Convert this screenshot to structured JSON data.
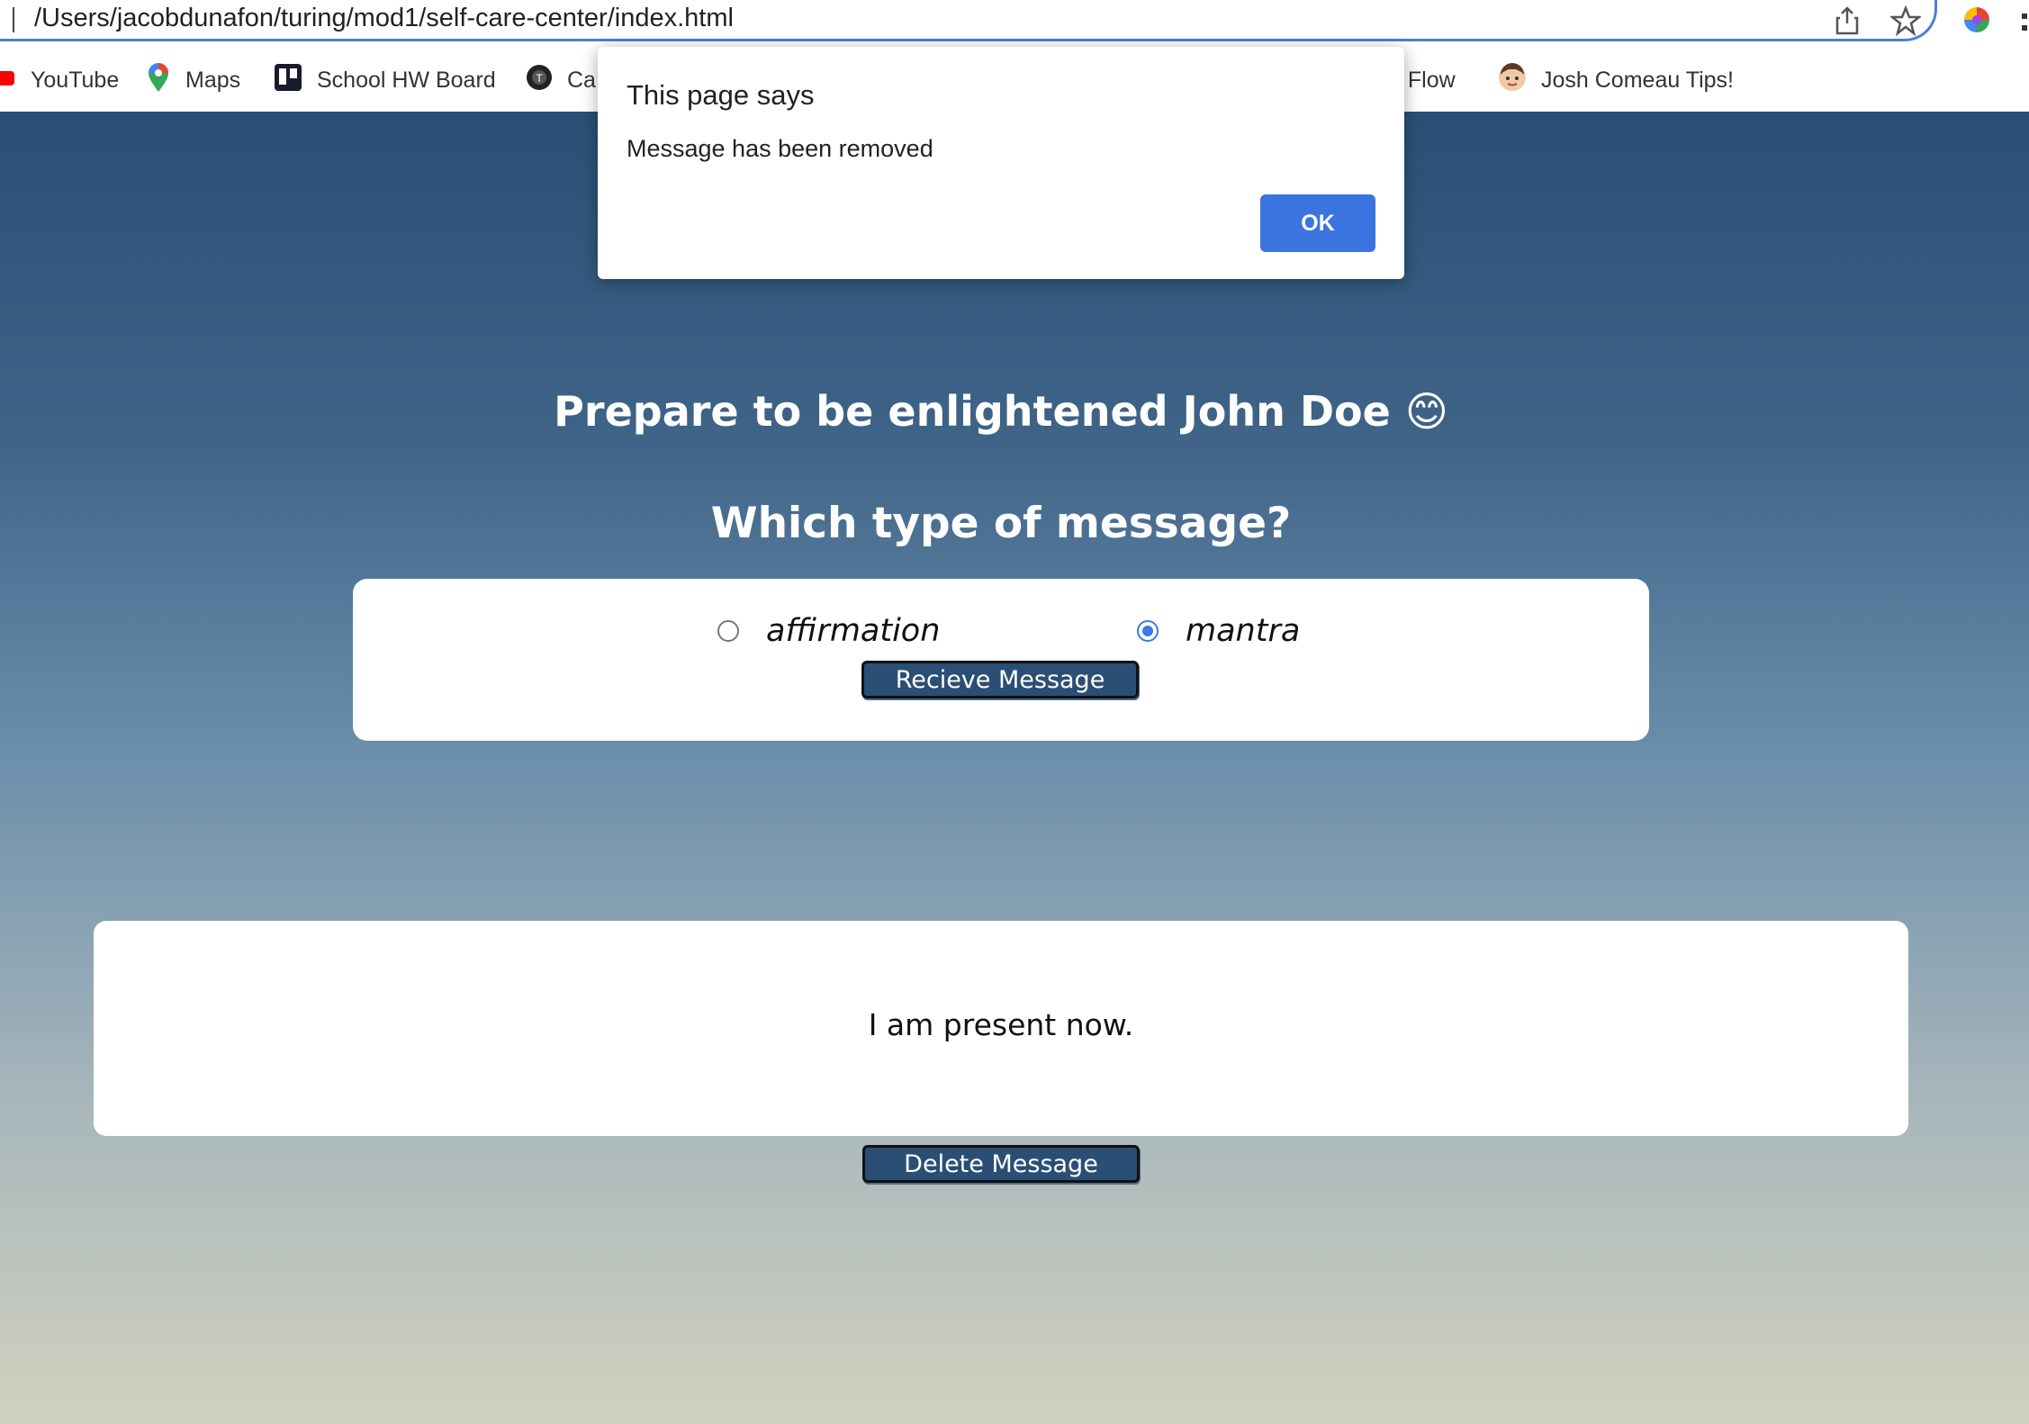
{
  "browser": {
    "url": "/Users/jacobdunafon/turing/mod1/self-care-center/index.html",
    "icons": [
      "share-icon",
      "star-icon",
      "extension-color-wheel-icon"
    ],
    "bookmarks": [
      {
        "label": "YouTube",
        "icon": "youtube-icon"
      },
      {
        "label": "Maps",
        "icon": "maps-pin-icon"
      },
      {
        "label": "School HW Board",
        "icon": "trello-icon"
      },
      {
        "label": "Ca",
        "icon": "circle-logo-icon"
      },
      {
        "label": "t Flow",
        "icon": ""
      },
      {
        "label": "Josh Comeau Tips!",
        "icon": "avatar-icon"
      }
    ]
  },
  "alert": {
    "title": "This page says",
    "message": "Message has been removed",
    "ok_label": "OK"
  },
  "page": {
    "greeting": "Prepare to be enlightened John Doe 😊",
    "question": "Which type of message?",
    "options": [
      {
        "label": "affirmation",
        "checked": false
      },
      {
        "label": "mantra",
        "checked": true
      }
    ],
    "receive_label": "Recieve Message",
    "message": "I am present now.",
    "delete_label": "Delete Message"
  },
  "colors": {
    "accent": "#3b74e0",
    "button_bg": "#2b4e74",
    "gradient_top": "#2a4f75",
    "gradient_bottom": "#d1d1bf"
  }
}
